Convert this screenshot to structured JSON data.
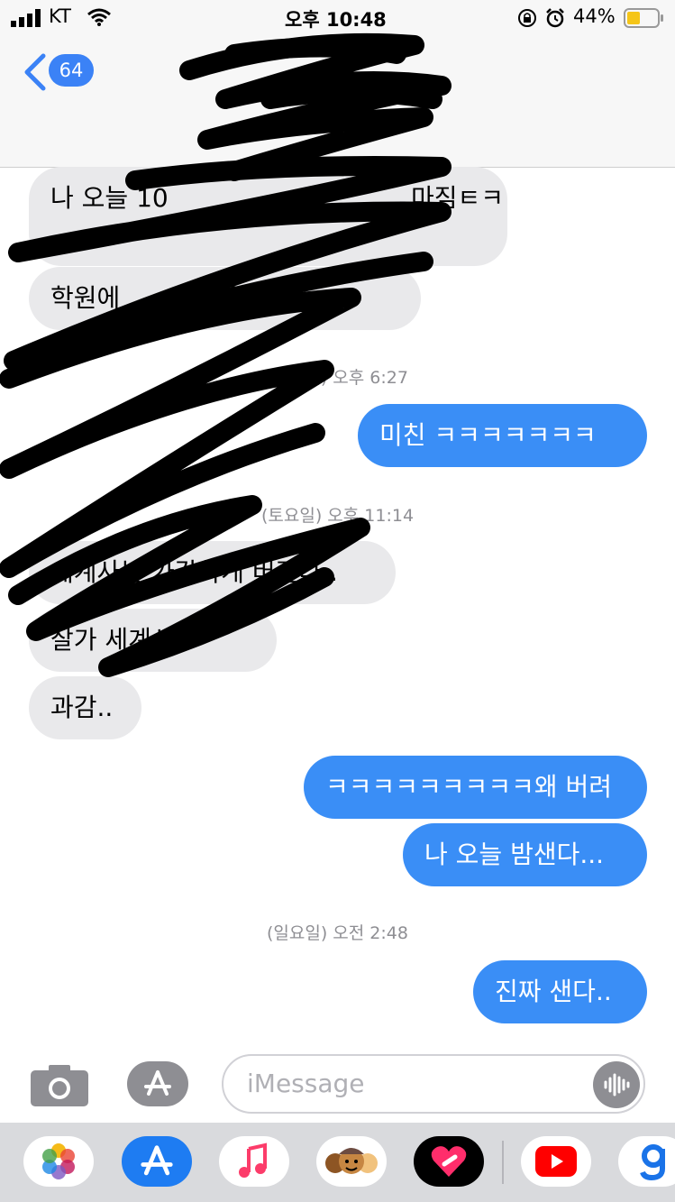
{
  "status_bar": {
    "carrier": "KT",
    "time": "오후 10:48",
    "battery_percent": "44%"
  },
  "header": {
    "unread_count": "64"
  },
  "messages": [
    {
      "text": "나 오늘 10",
      "tail_text": "마짐ㅌㅋ",
      "direction": "received"
    },
    {
      "text": "학원에",
      "tail_text": "를 묻게",
      "direction": "received"
    },
    {
      "timestamp": "(토요일) 오후 6:27"
    },
    {
      "text": "미친 ㅋㅋㅋㅋㅋㅋㅋ",
      "direction": "sent"
    },
    {
      "timestamp": "(토요일) 오후 11:14"
    },
    {
      "text": "세계사는 가감하게 버린다..",
      "direction": "received"
    },
    {
      "text": "잘가 세계사..",
      "direction": "received"
    },
    {
      "text": "과감..",
      "direction": "received"
    },
    {
      "text": "ㅋㅋㅋㅋㅋㅋㅋㅋㅋ왜 버려",
      "direction": "sent"
    },
    {
      "text": "나 오늘 밤샌다...",
      "direction": "sent"
    },
    {
      "timestamp": "(일요일) 오전 2:48"
    },
    {
      "text": "진짜 샌다..",
      "direction": "sent"
    }
  ],
  "input": {
    "placeholder": "iMessage"
  },
  "app_tray": [
    "photos-icon",
    "app-store-icon",
    "music-icon",
    "memoji-icon",
    "digital-touch-icon",
    "youtube-icon",
    "google-icon"
  ],
  "colors": {
    "sent_bubble": "#3a8ef6",
    "received_bubble": "#e9e9eb",
    "accent": "#3b82f6"
  }
}
